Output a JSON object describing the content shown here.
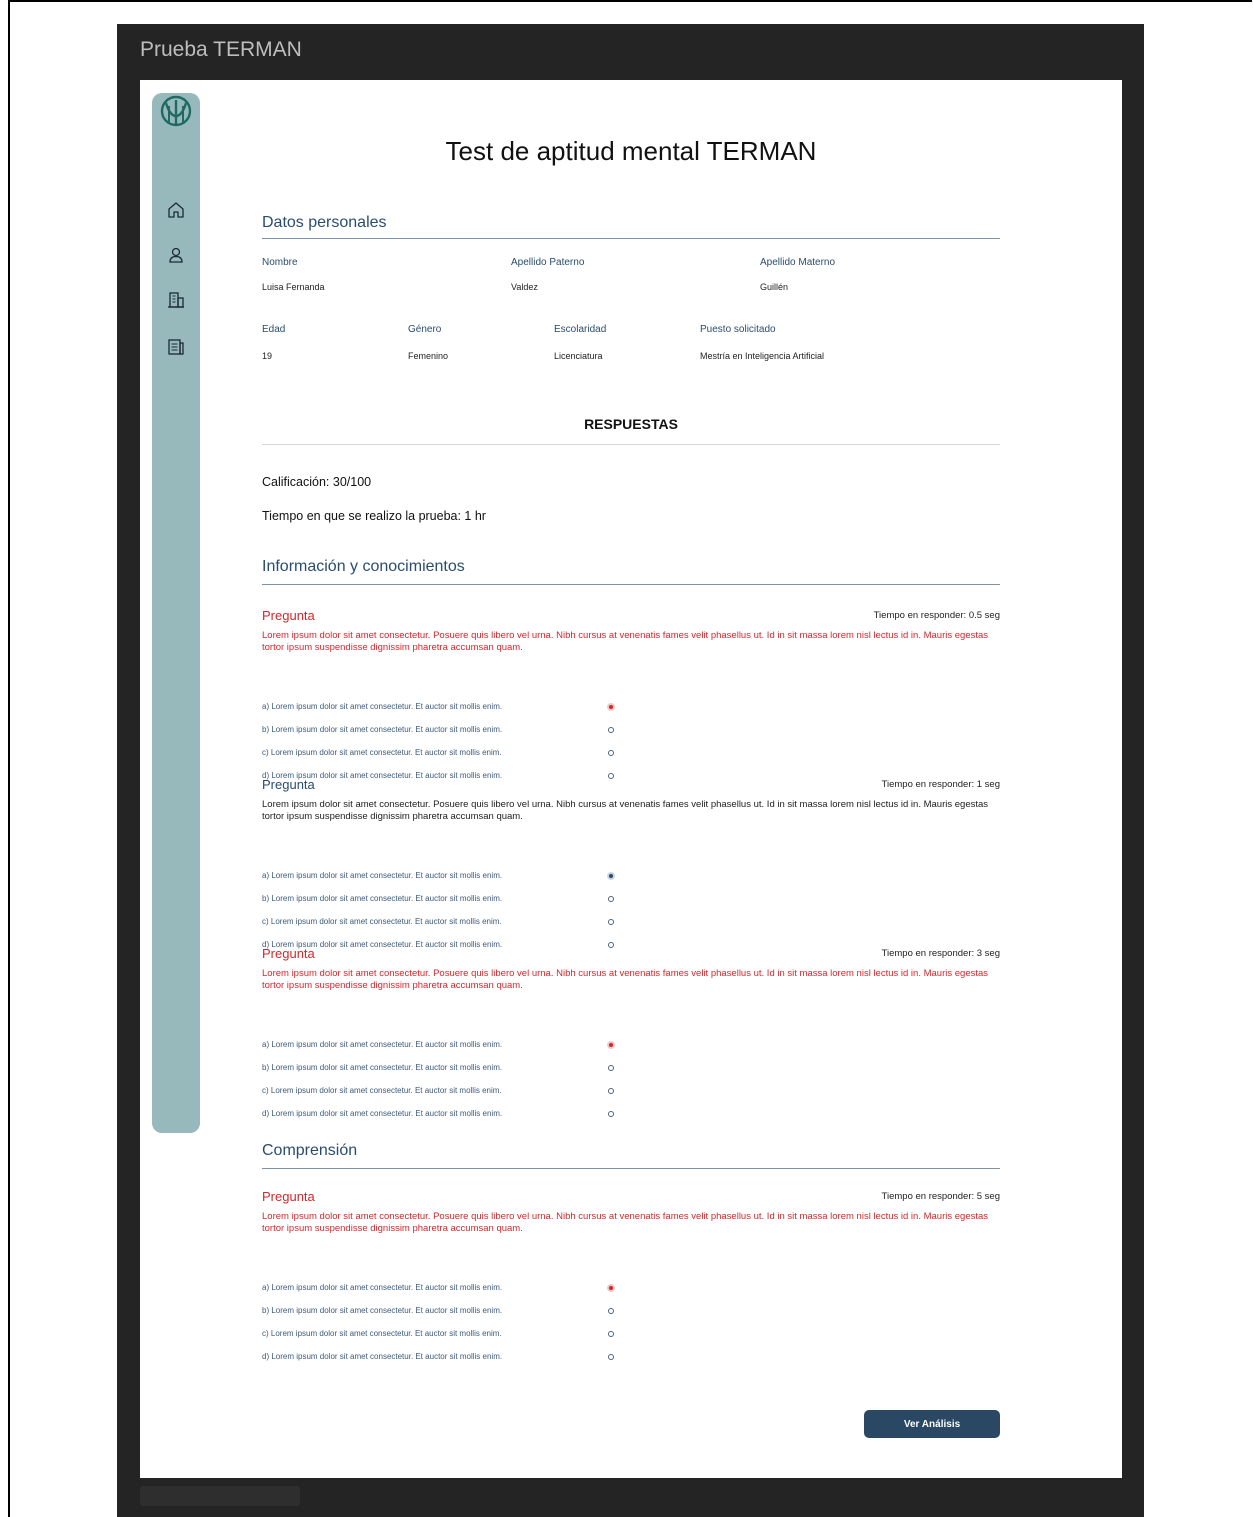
{
  "app": {
    "title": "Prueba TERMAN"
  },
  "sidebar": {
    "items": [
      {
        "icon": "home-icon"
      },
      {
        "icon": "user-icon"
      },
      {
        "icon": "building-icon"
      },
      {
        "icon": "document-icon"
      }
    ]
  },
  "page": {
    "title": "Test de aptitud mental TERMAN"
  },
  "personal": {
    "section_title": "Datos personales",
    "nombre_label": "Nombre",
    "nombre_value": "Luisa Fernanda",
    "apellido_paterno_label": "Apellido Paterno",
    "apellido_paterno_value": "Valdez",
    "apellido_materno_label": "Apellido Materno",
    "apellido_materno_value": "Guillén",
    "edad_label": "Edad",
    "edad_value": "19",
    "genero_label": "Género",
    "genero_value": "Femenino",
    "escolaridad_label": "Escolaridad",
    "escolaridad_value": "Licenciatura",
    "puesto_label": "Puesto solicitado",
    "puesto_value": "Mestría en Inteligencia Artificial"
  },
  "responses": {
    "title": "RESPUESTAS",
    "score": "Calificación: 30/100",
    "time": "Tiempo en que se realizo la prueba: 1 hr"
  },
  "sections": [
    {
      "title": "Información y conocimientos",
      "questions": [
        {
          "label": "Pregunta",
          "status": "incorrect",
          "time": "Tiempo en responder: 0.5 seg",
          "text": "Lorem ipsum dolor sit amet consectetur. Posuere quis libero vel urna. Nibh cursus at venenatis fames velit phasellus ut. Id in sit massa lorem nisl lectus id in. Mauris egestas tortor ipsum suspendisse dignissim pharetra accumsan quam.",
          "options": [
            "a) Lorem ipsum dolor sit amet consectetur. Et auctor sit mollis enim.",
            "b) Lorem ipsum dolor sit amet consectetur. Et auctor sit mollis enim.",
            "c) Lorem ipsum dolor sit amet consectetur. Et auctor sit mollis enim.",
            "d) Lorem ipsum dolor sit amet consectetur. Et auctor sit mollis enim."
          ],
          "selected": 0
        },
        {
          "label": "Pregunta",
          "status": "correct",
          "time": "Tiempo en responder: 1 seg",
          "text": "Lorem ipsum dolor sit amet consectetur. Posuere quis libero vel urna. Nibh cursus at venenatis fames velit phasellus ut. Id in sit massa lorem nisl lectus id in. Mauris egestas tortor ipsum suspendisse dignissim pharetra accumsan quam.",
          "options": [
            "a) Lorem ipsum dolor sit amet consectetur. Et auctor sit mollis enim.",
            "b) Lorem ipsum dolor sit amet consectetur. Et auctor sit mollis enim.",
            "c) Lorem ipsum dolor sit amet consectetur. Et auctor sit mollis enim.",
            "d) Lorem ipsum dolor sit amet consectetur. Et auctor sit mollis enim."
          ],
          "selected": 0
        },
        {
          "label": "Pregunta",
          "status": "incorrect",
          "time": "Tiempo en responder: 3 seg",
          "text": "Lorem ipsum dolor sit amet consectetur. Posuere quis libero vel urna. Nibh cursus at venenatis fames velit phasellus ut. Id in sit massa lorem nisl lectus id in. Mauris egestas tortor ipsum suspendisse dignissim pharetra accumsan quam.",
          "options": [
            "a) Lorem ipsum dolor sit amet consectetur. Et auctor sit mollis enim.",
            "b) Lorem ipsum dolor sit amet consectetur. Et auctor sit mollis enim.",
            "c) Lorem ipsum dolor sit amet consectetur. Et auctor sit mollis enim.",
            "d) Lorem ipsum dolor sit amet consectetur. Et auctor sit mollis enim."
          ],
          "selected": 0
        }
      ]
    },
    {
      "title": "Comprensión",
      "questions": [
        {
          "label": "Pregunta",
          "status": "incorrect",
          "time": "Tiempo en responder: 5 seg",
          "text": "Lorem ipsum dolor sit amet consectetur. Posuere quis libero vel urna. Nibh cursus at venenatis fames velit phasellus ut. Id in sit massa lorem nisl lectus id in. Mauris egestas tortor ipsum suspendisse dignissim pharetra accumsan quam.",
          "options": [
            "a) Lorem ipsum dolor sit amet consectetur. Et auctor sit mollis enim.",
            "b) Lorem ipsum dolor sit amet consectetur. Et auctor sit mollis enim.",
            "c) Lorem ipsum dolor sit amet consectetur. Et auctor sit mollis enim.",
            "d) Lorem ipsum dolor sit amet consectetur. Et auctor sit mollis enim."
          ],
          "selected": 0
        }
      ]
    }
  ],
  "actions": {
    "analysis_label": "Ver Análisis"
  },
  "colors": {
    "incorrect": "#d6262b",
    "correct": "#2a4d6e",
    "sidebar": "#97b9bc",
    "button": "#2a4763"
  }
}
